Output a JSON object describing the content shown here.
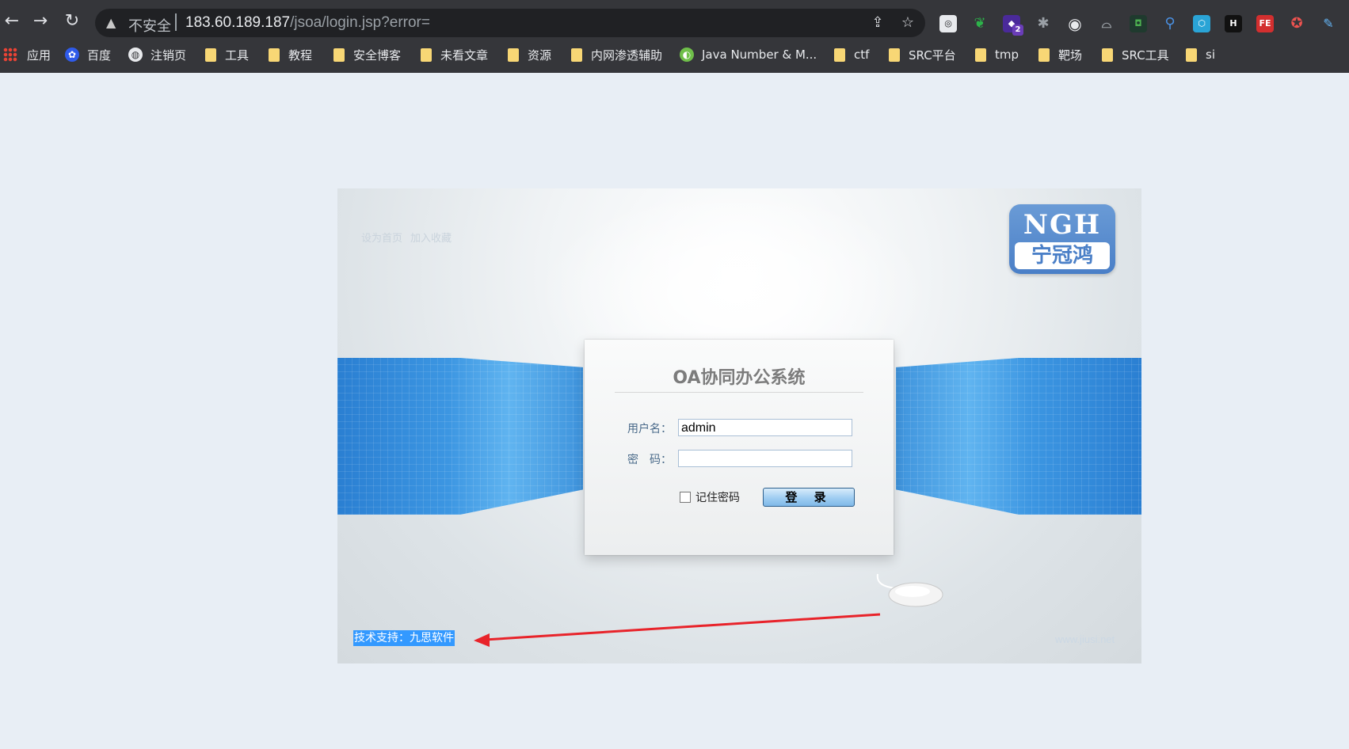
{
  "browser": {
    "security_label": "不安全",
    "url_host": "183.60.189.187",
    "url_path": "/jsoa/login.jsp?error=",
    "extension_badge": "2",
    "extensions": {
      "fe_label": "FE",
      "h_label": "H"
    }
  },
  "bookmarks": [
    {
      "label": "应用",
      "icon": "apps-grid-icon"
    },
    {
      "label": "百度",
      "icon": "baidu-icon"
    },
    {
      "label": "注销页",
      "icon": "globe-icon"
    },
    {
      "label": "工具",
      "icon": "folder-icon"
    },
    {
      "label": "教程",
      "icon": "folder-icon"
    },
    {
      "label": "安全博客",
      "icon": "folder-icon"
    },
    {
      "label": "未看文章",
      "icon": "folder-icon"
    },
    {
      "label": "资源",
      "icon": "folder-icon"
    },
    {
      "label": "内网渗透辅助",
      "icon": "folder-icon"
    },
    {
      "label": "Java Number & M...",
      "icon": "site-icon"
    },
    {
      "label": "ctf",
      "icon": "folder-icon"
    },
    {
      "label": "SRC平台",
      "icon": "folder-icon"
    },
    {
      "label": "tmp",
      "icon": "folder-icon"
    },
    {
      "label": "靶场",
      "icon": "folder-icon"
    },
    {
      "label": "SRC工具",
      "icon": "folder-icon"
    },
    {
      "label": "si",
      "icon": "folder-icon"
    }
  ],
  "page": {
    "top_links": {
      "set_home": "设为首页",
      "add_favorite": "加入收藏"
    },
    "logo": {
      "top_text": "NGH",
      "bottom_text": "宁冠鸿"
    },
    "login": {
      "title": "OA协同办公系统",
      "username_label": "用户名：",
      "username_value": "admin",
      "password_label": "密　码：",
      "password_value": "",
      "remember_label": "记住密码",
      "remember_checked": false,
      "login_button": "登 录"
    },
    "footer": {
      "support": "技术支持：九思软件",
      "website": "www.jiusi.net"
    },
    "annotation": {
      "color": "#e8232a"
    }
  }
}
